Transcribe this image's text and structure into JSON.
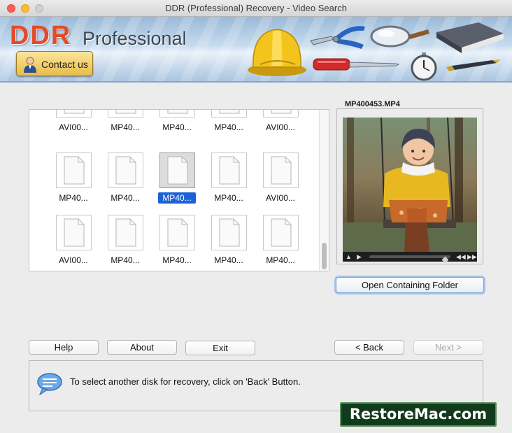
{
  "window": {
    "title": "DDR (Professional) Recovery - Video Search"
  },
  "banner": {
    "logo_main": "DDR",
    "logo_sub": "Professional",
    "contact_label": "Contact us"
  },
  "files": {
    "row1": [
      "AVI00...",
      "MP40...",
      "MP40...",
      "MP40...",
      "AVI00..."
    ],
    "row2": [
      "MP40...",
      "MP40...",
      "MP40...",
      "MP40...",
      "AVI00..."
    ],
    "row3": [
      "AVI00...",
      "MP40...",
      "MP40...",
      "MP40...",
      "MP40..."
    ],
    "selected_index": 7
  },
  "preview": {
    "filename": "MP400453.MP4",
    "open_folder_label": "Open Containing Folder"
  },
  "buttons": {
    "help": "Help",
    "about": "About",
    "exit": "Exit",
    "back": "< Back",
    "next": "Next >"
  },
  "info": {
    "message": "To select another disk for recovery, click on 'Back' Button."
  },
  "watermark": {
    "text": "RestoreMac.com"
  },
  "colors": {
    "accent": "#1b62d6",
    "logo": "#e34b27",
    "contact_button": "#f0cf6a"
  }
}
